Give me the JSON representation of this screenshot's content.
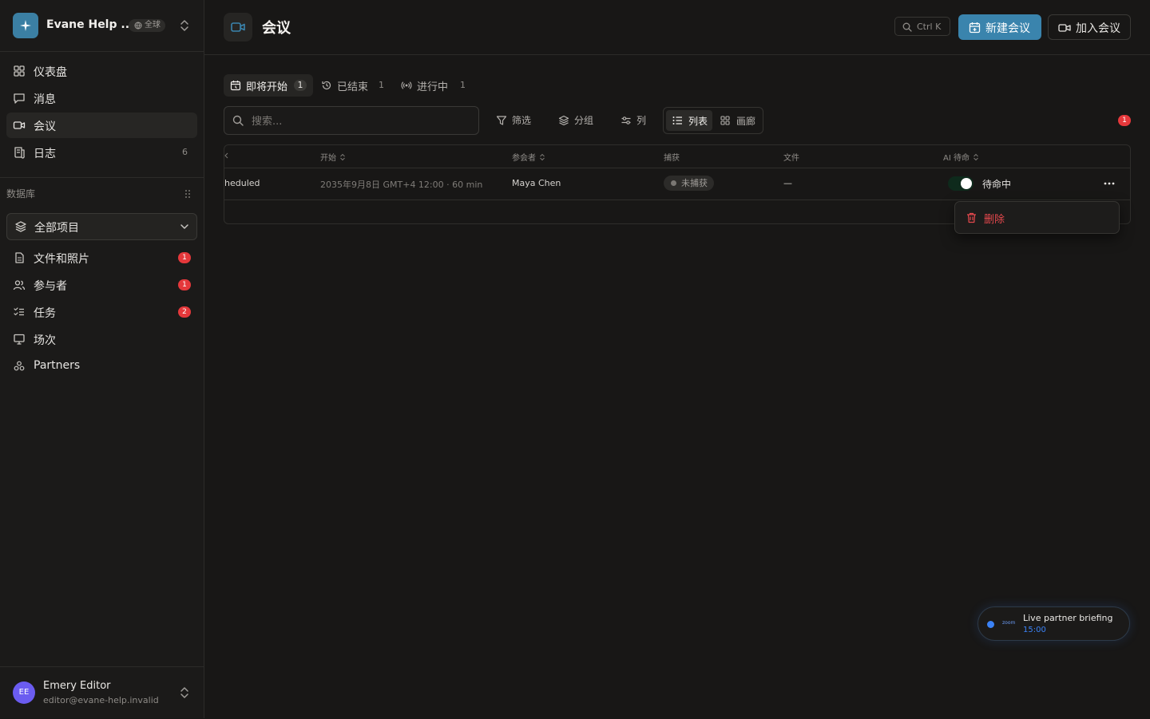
{
  "colors": {
    "accent": "#3a84ad",
    "danger": "#e5484d",
    "badge": "#e5383b",
    "live": "#3b82f6"
  },
  "workspace": {
    "name": "Evane Help ...",
    "scope_badge": "全球"
  },
  "nav": [
    {
      "label": "仪表盘",
      "icon": "dashboard-icon"
    },
    {
      "label": "消息",
      "icon": "message-icon"
    },
    {
      "label": "会议",
      "icon": "video-icon",
      "active": true
    },
    {
      "label": "日志",
      "icon": "log-icon",
      "count": "6"
    }
  ],
  "database": {
    "title": "数据库",
    "selector": "全部项目",
    "items": [
      {
        "label": "文件和照片",
        "badge": "1"
      },
      {
        "label": "参与者",
        "badge": "1"
      },
      {
        "label": "任务",
        "badge": "2"
      },
      {
        "label": "场次"
      },
      {
        "label": "Partners"
      }
    ]
  },
  "user": {
    "initials": "EE",
    "name": "Emery Editor",
    "email": "editor@evane-help.invalid"
  },
  "header": {
    "title": "会议",
    "shortcut": "Ctrl K",
    "new_meeting": "新建会议",
    "join_meeting": "加入会议"
  },
  "tabs": [
    {
      "label": "即将开始",
      "count": "1"
    },
    {
      "label": "已结束",
      "count": "1"
    },
    {
      "label": "进行中",
      "count": "1"
    }
  ],
  "toolbar": {
    "search_placeholder": "搜索...",
    "filter": "筛选",
    "group": "分组",
    "columns": "列",
    "view_list": "列表",
    "view_gallery": "画廊",
    "notification_count": "1"
  },
  "table": {
    "headers": [
      "开始",
      "参会者",
      "捕获",
      "文件",
      "AI 待命"
    ],
    "rows": [
      {
        "status": "heduled",
        "start": "2035年9月8日 GMT+4 12:00",
        "duration": "· 60 min",
        "participant": "Maya Chen",
        "capture": "未捕获",
        "files": "—",
        "ai_standby": "待命中"
      }
    ]
  },
  "row_menu": {
    "delete": "删除"
  },
  "live_meeting": {
    "title": "Live partner briefing",
    "time": "15:00",
    "provider": "zoom"
  }
}
